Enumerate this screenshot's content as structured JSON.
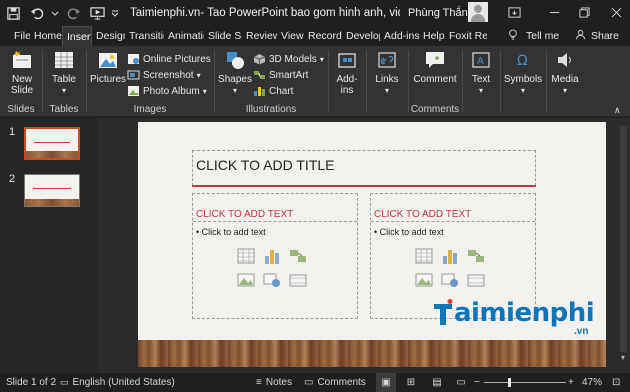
{
  "titlebar": {
    "title": "Taimienphi.vn- Tao PowerPoint bao gom hinh anh, video, loi cam...",
    "user": "Phùng Thắng"
  },
  "tabs": [
    "File",
    "Home",
    "Insert",
    "Design",
    "Transitio",
    "Animatic",
    "Slide Sho",
    "Review",
    "View",
    "Recordir",
    "Develop",
    "Add-ins",
    "Help",
    "Foxit Rea"
  ],
  "active_tab": "Insert",
  "tell_me": "Tell me",
  "share": "Share",
  "ribbon": {
    "slides": {
      "new_slide": "New",
      "new_slide_2": "Slide",
      "label": "Slides"
    },
    "tables": {
      "table": "Table",
      "label": "Tables"
    },
    "images": {
      "pictures": "Pictures",
      "online_pictures": "Online Pictures",
      "screenshot": "Screenshot",
      "photo_album": "Photo Album",
      "label": "Images"
    },
    "illustrations": {
      "shapes": "Shapes",
      "models": "3D Models",
      "smartart": "SmartArt",
      "chart": "Chart",
      "label": "Illustrations"
    },
    "addins": {
      "label1": "Add-",
      "label2": "ins"
    },
    "links": {
      "label": "Links"
    },
    "comments": {
      "comment": "Comment",
      "label": "Comments"
    },
    "text": {
      "label": "Text"
    },
    "symbols": {
      "label": "Symbols"
    },
    "media": {
      "label": "Media"
    }
  },
  "thumbnails": [
    {
      "num": "1"
    },
    {
      "num": "2"
    }
  ],
  "slide": {
    "title_placeholder": "CLICK TO ADD TITLE",
    "left_heading": "CLICK TO ADD TEXT",
    "left_bullet": "Click to add text",
    "right_heading": "CLICK TO ADD TEXT",
    "right_bullet": "Click to add text"
  },
  "watermark": {
    "brand": "aimienphi",
    "tld": ".vn"
  },
  "status": {
    "slide_of": "Slide 1 of 2",
    "language": "English (United States)",
    "notes": "Notes",
    "comments": "Comments",
    "zoom": "47%"
  },
  "colors": {
    "accent_red": "#c0394a",
    "selected_thumb": "#d24726",
    "watermark_blue": "#0d75b9"
  }
}
